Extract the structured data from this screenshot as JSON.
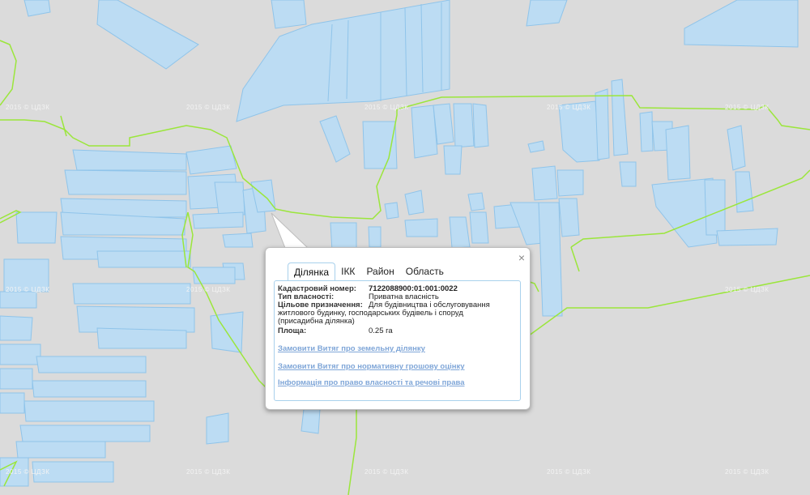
{
  "map": {
    "watermark": "2015 © ЦДЗК",
    "colors": {
      "background": "#dbdbdb",
      "parcel_fill": "#bcdcf3",
      "parcel_stroke": "#8fc4ea",
      "boundary": "#9be63b"
    }
  },
  "popup": {
    "close_glyph": "×",
    "tabs": [
      {
        "label": "Ділянка",
        "active": true
      },
      {
        "label": "ІКК",
        "active": false
      },
      {
        "label": "Район",
        "active": false
      },
      {
        "label": "Область",
        "active": false
      }
    ],
    "fields": {
      "cadastral_label": "Кадастровий номер:",
      "cadastral_value": "7122088900:01:001:0022",
      "ownership_label": "Тип власності:",
      "ownership_value": "Приватна власність",
      "purpose_label": "Цільове призначення:",
      "purpose_value_1": "Для будівництва і обслуговування",
      "purpose_value_2": "житлового будинку, господарських будівель і споруд",
      "purpose_value_3": "(присадибна ділянка)",
      "area_label": "Площа:",
      "area_value": "0.25 га"
    },
    "links": [
      "Замовити Витяг про земельну ділянку",
      "Замовити Витяг про нормативну грошову оцінку",
      "Інформація про право власності та речові права"
    ]
  }
}
